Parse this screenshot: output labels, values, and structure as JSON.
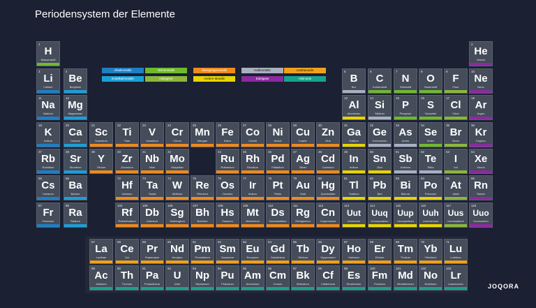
{
  "title": "Periodensystem der Elemente",
  "brand": "JOQORA",
  "colors": {
    "alkali": "#1e7fc4",
    "alkaline": "#1aa0d8",
    "nonmetal": "#6fba2c",
    "transition": "#f08a1c",
    "post": "#e8d400",
    "metalloid": "#a9b0bf",
    "halogen": "#8ab83a",
    "noble": "#8c2aa0",
    "lanth": "#f2a01a",
    "actin": "#19a38c",
    "hydrogen": "#6fba2c",
    "unknown": "#4f5565"
  },
  "legend": [
    {
      "label": "Alkalimetalle",
      "cat": "alkali"
    },
    {
      "label": "Erdalkalimetalle",
      "cat": "alkaline"
    },
    {
      "label": "Nichtmetalle",
      "cat": "nonmetal"
    },
    {
      "label": "Übergangsmetalle",
      "cat": "transition"
    },
    {
      "label": "Halbmetalle",
      "cat": "metalloid"
    },
    {
      "label": "Lanthanoide",
      "cat": "lanth"
    },
    {
      "label": "Andere Metalle",
      "cat": "post"
    },
    {
      "label": "Halogene",
      "cat": "halogen"
    },
    {
      "label": "Edelgase",
      "cat": "noble"
    },
    {
      "label": "Aktinoide",
      "cat": "actin"
    },
    {
      "label": "Unbekannt",
      "cat": "unknown"
    }
  ],
  "elements": [
    {
      "n": 1,
      "s": "H",
      "name": "Wasserstoff",
      "c": "hydrogen",
      "r": 1,
      "g": 1
    },
    {
      "n": 2,
      "s": "He",
      "name": "Helium",
      "c": "noble",
      "r": 1,
      "g": 18
    },
    {
      "n": 3,
      "s": "Li",
      "name": "Lithium",
      "c": "alkali",
      "r": 2,
      "g": 1
    },
    {
      "n": 4,
      "s": "Be",
      "name": "Beryllium",
      "c": "alkaline",
      "r": 2,
      "g": 2
    },
    {
      "n": 5,
      "s": "B",
      "name": "Bor",
      "c": "metalloid",
      "r": 2,
      "g": 13
    },
    {
      "n": 6,
      "s": "C",
      "name": "Kohlenstoff",
      "c": "nonmetal",
      "r": 2,
      "g": 14
    },
    {
      "n": 7,
      "s": "N",
      "name": "Stickstoff",
      "c": "nonmetal",
      "r": 2,
      "g": 15
    },
    {
      "n": 8,
      "s": "O",
      "name": "Sauerstoff",
      "c": "nonmetal",
      "r": 2,
      "g": 16
    },
    {
      "n": 9,
      "s": "F",
      "name": "Fluor",
      "c": "halogen",
      "r": 2,
      "g": 17
    },
    {
      "n": 10,
      "s": "Ne",
      "name": "Neon",
      "c": "noble",
      "r": 2,
      "g": 18
    },
    {
      "n": 11,
      "s": "Na",
      "name": "Natrium",
      "c": "alkali",
      "r": 3,
      "g": 1
    },
    {
      "n": 12,
      "s": "Mg",
      "name": "Magnesium",
      "c": "alkaline",
      "r": 3,
      "g": 2
    },
    {
      "n": 13,
      "s": "Al",
      "name": "Aluminium",
      "c": "post",
      "r": 3,
      "g": 13
    },
    {
      "n": 14,
      "s": "Si",
      "name": "Silizium",
      "c": "metalloid",
      "r": 3,
      "g": 14
    },
    {
      "n": 15,
      "s": "P",
      "name": "Phosphor",
      "c": "nonmetal",
      "r": 3,
      "g": 15
    },
    {
      "n": 16,
      "s": "S",
      "name": "Schwefel",
      "c": "nonmetal",
      "r": 3,
      "g": 16
    },
    {
      "n": 17,
      "s": "Cl",
      "name": "Chlor",
      "c": "halogen",
      "r": 3,
      "g": 17
    },
    {
      "n": 18,
      "s": "Ar",
      "name": "Argon",
      "c": "noble",
      "r": 3,
      "g": 18
    },
    {
      "n": 19,
      "s": "K",
      "name": "Kalium",
      "c": "alkali",
      "r": 4,
      "g": 1
    },
    {
      "n": 20,
      "s": "Ca",
      "name": "Calcium",
      "c": "alkaline",
      "r": 4,
      "g": 2
    },
    {
      "n": 21,
      "s": "Sc",
      "name": "Scandium",
      "c": "transition",
      "r": 4,
      "g": 3
    },
    {
      "n": 22,
      "s": "Ti",
      "name": "Titan",
      "c": "transition",
      "r": 4,
      "g": 4
    },
    {
      "n": 23,
      "s": "V",
      "name": "Vanadium",
      "c": "transition",
      "r": 4,
      "g": 5
    },
    {
      "n": 24,
      "s": "Cr",
      "name": "Chrom",
      "c": "transition",
      "r": 4,
      "g": 6
    },
    {
      "n": 25,
      "s": "Mn",
      "name": "Mangan",
      "c": "transition",
      "r": 4,
      "g": 7
    },
    {
      "n": 26,
      "s": "Fe",
      "name": "Eisen",
      "c": "transition",
      "r": 4,
      "g": 8
    },
    {
      "n": 27,
      "s": "Co",
      "name": "Cobalt",
      "c": "transition",
      "r": 4,
      "g": 9
    },
    {
      "n": 28,
      "s": "Ni",
      "name": "Nickel",
      "c": "transition",
      "r": 4,
      "g": 10
    },
    {
      "n": 29,
      "s": "Cu",
      "name": "Kupfer",
      "c": "transition",
      "r": 4,
      "g": 11
    },
    {
      "n": 30,
      "s": "Zn",
      "name": "Zink",
      "c": "transition",
      "r": 4,
      "g": 12
    },
    {
      "n": 31,
      "s": "Ga",
      "name": "Gallium",
      "c": "post",
      "r": 4,
      "g": 13
    },
    {
      "n": 32,
      "s": "Ge",
      "name": "Germanium",
      "c": "metalloid",
      "r": 4,
      "g": 14
    },
    {
      "n": 33,
      "s": "As",
      "name": "Arsen",
      "c": "metalloid",
      "r": 4,
      "g": 15
    },
    {
      "n": 34,
      "s": "Se",
      "name": "Selen",
      "c": "nonmetal",
      "r": 4,
      "g": 16
    },
    {
      "n": 35,
      "s": "Br",
      "name": "Brom",
      "c": "halogen",
      "r": 4,
      "g": 17
    },
    {
      "n": 36,
      "s": "Kr",
      "name": "Krypton",
      "c": "noble",
      "r": 4,
      "g": 18
    },
    {
      "n": 37,
      "s": "Rb",
      "name": "Rubidium",
      "c": "alkali",
      "r": 5,
      "g": 1
    },
    {
      "n": 38,
      "s": "Sr",
      "name": "Strontium",
      "c": "alkaline",
      "r": 5,
      "g": 2
    },
    {
      "n": 39,
      "s": "Y",
      "name": "Yttrium",
      "c": "transition",
      "r": 5,
      "g": 3
    },
    {
      "n": 40,
      "s": "Zr",
      "name": "Zirconium",
      "c": "transition",
      "r": 5,
      "g": 4
    },
    {
      "n": 41,
      "s": "Nb",
      "name": "Niob",
      "c": "transition",
      "r": 5,
      "g": 5
    },
    {
      "n": 42,
      "s": "Mo",
      "name": "Molybdän",
      "c": "transition",
      "r": 5,
      "g": 6
    },
    {
      "n": 44,
      "s": "Ru",
      "name": "Ruthenium",
      "c": "transition",
      "r": 5,
      "g": 8
    },
    {
      "n": 45,
      "s": "Rh",
      "name": "Rhodium",
      "c": "transition",
      "r": 5,
      "g": 9
    },
    {
      "n": 46,
      "s": "Pd",
      "name": "Palladium",
      "c": "transition",
      "r": 5,
      "g": 10
    },
    {
      "n": 47,
      "s": "Ag",
      "name": "Silber",
      "c": "transition",
      "r": 5,
      "g": 11
    },
    {
      "n": 48,
      "s": "Cd",
      "name": "Cadmium",
      "c": "transition",
      "r": 5,
      "g": 12
    },
    {
      "n": 49,
      "s": "In",
      "name": "Indium",
      "c": "post",
      "r": 5,
      "g": 13
    },
    {
      "n": 50,
      "s": "Sn",
      "name": "Zinn",
      "c": "post",
      "r": 5,
      "g": 14
    },
    {
      "n": 51,
      "s": "Sb",
      "name": "Antimon",
      "c": "metalloid",
      "r": 5,
      "g": 15
    },
    {
      "n": 52,
      "s": "Te",
      "name": "Tellur",
      "c": "metalloid",
      "r": 5,
      "g": 16
    },
    {
      "n": 53,
      "s": "I",
      "name": "Iod",
      "c": "halogen",
      "r": 5,
      "g": 17
    },
    {
      "n": 54,
      "s": "Xe",
      "name": "Xenon",
      "c": "noble",
      "r": 5,
      "g": 18
    },
    {
      "n": 55,
      "s": "Cs",
      "name": "Caesium",
      "c": "alkali",
      "r": 6,
      "g": 1
    },
    {
      "n": 56,
      "s": "Ba",
      "name": "Barium",
      "c": "alkaline",
      "r": 6,
      "g": 2
    },
    {
      "n": 72,
      "s": "Hf",
      "name": "Hafnium",
      "c": "transition",
      "r": 6,
      "g": 4
    },
    {
      "n": 73,
      "s": "Ta",
      "name": "Tantal",
      "c": "transition",
      "r": 6,
      "g": 5
    },
    {
      "n": 74,
      "s": "W",
      "name": "Wolfram",
      "c": "transition",
      "r": 6,
      "g": 6
    },
    {
      "n": 75,
      "s": "Re",
      "name": "Rhenium",
      "c": "transition",
      "r": 6,
      "g": 7
    },
    {
      "n": 76,
      "s": "Os",
      "name": "Osmium",
      "c": "transition",
      "r": 6,
      "g": 8
    },
    {
      "n": 77,
      "s": "Ir",
      "name": "Iridium",
      "c": "transition",
      "r": 6,
      "g": 9
    },
    {
      "n": 78,
      "s": "Pt",
      "name": "Platin",
      "c": "transition",
      "r": 6,
      "g": 10
    },
    {
      "n": 79,
      "s": "Au",
      "name": "Gold",
      "c": "transition",
      "r": 6,
      "g": 11
    },
    {
      "n": 80,
      "s": "Hg",
      "name": "Quecksilber",
      "c": "transition",
      "r": 6,
      "g": 12
    },
    {
      "n": 81,
      "s": "Tl",
      "name": "Thallium",
      "c": "post",
      "r": 6,
      "g": 13
    },
    {
      "n": 82,
      "s": "Pb",
      "name": "Blei",
      "c": "post",
      "r": 6,
      "g": 14
    },
    {
      "n": 83,
      "s": "Bi",
      "name": "Bismut",
      "c": "post",
      "r": 6,
      "g": 15
    },
    {
      "n": 84,
      "s": "Po",
      "name": "Polonium",
      "c": "post",
      "r": 6,
      "g": 16
    },
    {
      "n": 85,
      "s": "At",
      "name": "Astat",
      "c": "halogen",
      "r": 6,
      "g": 17
    },
    {
      "n": 86,
      "s": "Rn",
      "name": "Radon",
      "c": "noble",
      "r": 6,
      "g": 18
    },
    {
      "n": 87,
      "s": "Fr",
      "name": "Francium",
      "c": "alkali",
      "r": 7,
      "g": 1
    },
    {
      "n": 88,
      "s": "Ra",
      "name": "Radium",
      "c": "alkaline",
      "r": 7,
      "g": 2
    },
    {
      "n": 104,
      "s": "Rf",
      "name": "Rutherfordium",
      "c": "transition",
      "r": 7,
      "g": 4
    },
    {
      "n": 105,
      "s": "Db",
      "name": "Dubnium",
      "c": "transition",
      "r": 7,
      "g": 5
    },
    {
      "n": 106,
      "s": "Sg",
      "name": "Seaborgium",
      "c": "transition",
      "r": 7,
      "g": 6
    },
    {
      "n": 107,
      "s": "Bh",
      "name": "Bohrium",
      "c": "transition",
      "r": 7,
      "g": 7
    },
    {
      "n": 108,
      "s": "Hs",
      "name": "Hassium",
      "c": "transition",
      "r": 7,
      "g": 8
    },
    {
      "n": 109,
      "s": "Mt",
      "name": "Meitnerium",
      "c": "transition",
      "r": 7,
      "g": 9
    },
    {
      "n": 110,
      "s": "Ds",
      "name": "Darmstadtium",
      "c": "transition",
      "r": 7,
      "g": 10
    },
    {
      "n": 111,
      "s": "Rg",
      "name": "Röntgenium",
      "c": "transition",
      "r": 7,
      "g": 11
    },
    {
      "n": 112,
      "s": "Cn",
      "name": "Copernicium",
      "c": "transition",
      "r": 7,
      "g": 12
    },
    {
      "n": 113,
      "s": "Uut",
      "name": "Ununtrium",
      "c": "post",
      "r": 7,
      "g": 13
    },
    {
      "n": 114,
      "s": "Uuq",
      "name": "Ununquadium",
      "c": "post",
      "r": 7,
      "g": 14
    },
    {
      "n": 115,
      "s": "Uup",
      "name": "Ununpentium",
      "c": "post",
      "r": 7,
      "g": 15
    },
    {
      "n": 116,
      "s": "Uuh",
      "name": "Ununhexium",
      "c": "post",
      "r": 7,
      "g": 16
    },
    {
      "n": 117,
      "s": "Uus",
      "name": "Ununseptium",
      "c": "halogen",
      "r": 7,
      "g": 17
    },
    {
      "n": 118,
      "s": "Uuo",
      "name": "Ununoctium",
      "c": "noble",
      "r": 7,
      "g": 18
    },
    {
      "n": 57,
      "s": "La",
      "name": "Lanthan",
      "c": "lanth",
      "r": 9,
      "g": 3
    },
    {
      "n": 58,
      "s": "Ce",
      "name": "Cer",
      "c": "lanth",
      "r": 9,
      "g": 4
    },
    {
      "n": 59,
      "s": "Pr",
      "name": "Praseodym",
      "c": "lanth",
      "r": 9,
      "g": 5
    },
    {
      "n": 60,
      "s": "Nd",
      "name": "Neodym",
      "c": "lanth",
      "r": 9,
      "g": 6
    },
    {
      "n": 61,
      "s": "Pm",
      "name": "Promethium",
      "c": "lanth",
      "r": 9,
      "g": 7
    },
    {
      "n": 62,
      "s": "Sm",
      "name": "Samarium",
      "c": "lanth",
      "r": 9,
      "g": 8
    },
    {
      "n": 63,
      "s": "Eu",
      "name": "Europium",
      "c": "lanth",
      "r": 9,
      "g": 9
    },
    {
      "n": 64,
      "s": "Gd",
      "name": "Gadolinium",
      "c": "lanth",
      "r": 9,
      "g": 10
    },
    {
      "n": 65,
      "s": "Tb",
      "name": "Terbium",
      "c": "lanth",
      "r": 9,
      "g": 11
    },
    {
      "n": 66,
      "s": "Dy",
      "name": "Dysprosium",
      "c": "lanth",
      "r": 9,
      "g": 12
    },
    {
      "n": 67,
      "s": "Ho",
      "name": "Holmium",
      "c": "lanth",
      "r": 9,
      "g": 13
    },
    {
      "n": 68,
      "s": "Er",
      "name": "Erbium",
      "c": "lanth",
      "r": 9,
      "g": 14
    },
    {
      "n": 69,
      "s": "Tm",
      "name": "Thulium",
      "c": "lanth",
      "r": 9,
      "g": 15
    },
    {
      "n": 70,
      "s": "Yb",
      "name": "Ytterbium",
      "c": "lanth",
      "r": 9,
      "g": 16
    },
    {
      "n": 71,
      "s": "Lu",
      "name": "Lutetium",
      "c": "lanth",
      "r": 9,
      "g": 17
    },
    {
      "n": 89,
      "s": "Ac",
      "name": "Actinium",
      "c": "actin",
      "r": 10,
      "g": 3
    },
    {
      "n": 90,
      "s": "Th",
      "name": "Thorium",
      "c": "actin",
      "r": 10,
      "g": 4
    },
    {
      "n": 91,
      "s": "Pa",
      "name": "Protactinium",
      "c": "actin",
      "r": 10,
      "g": 5
    },
    {
      "n": 92,
      "s": "U",
      "name": "Uran",
      "c": "actin",
      "r": 10,
      "g": 6
    },
    {
      "n": 93,
      "s": "Np",
      "name": "Neptunium",
      "c": "actin",
      "r": 10,
      "g": 7
    },
    {
      "n": 94,
      "s": "Pu",
      "name": "Plutonium",
      "c": "actin",
      "r": 10,
      "g": 8
    },
    {
      "n": 95,
      "s": "Am",
      "name": "Americium",
      "c": "actin",
      "r": 10,
      "g": 9
    },
    {
      "n": 96,
      "s": "Cm",
      "name": "Curium",
      "c": "actin",
      "r": 10,
      "g": 10
    },
    {
      "n": 97,
      "s": "Bk",
      "name": "Berkelium",
      "c": "actin",
      "r": 10,
      "g": 11
    },
    {
      "n": 98,
      "s": "Cf",
      "name": "Californium",
      "c": "actin",
      "r": 10,
      "g": 12
    },
    {
      "n": 99,
      "s": "Es",
      "name": "Einsteinium",
      "c": "actin",
      "r": 10,
      "g": 13
    },
    {
      "n": 100,
      "s": "Fm",
      "name": "Fermium",
      "c": "actin",
      "r": 10,
      "g": 14
    },
    {
      "n": 101,
      "s": "Md",
      "name": "Mendelevium",
      "c": "actin",
      "r": 10,
      "g": 15
    },
    {
      "n": 102,
      "s": "No",
      "name": "Nobelium",
      "c": "actin",
      "r": 10,
      "g": 16
    },
    {
      "n": 103,
      "s": "Lr",
      "name": "Lawrencium",
      "c": "actin",
      "r": 10,
      "g": 17
    }
  ]
}
